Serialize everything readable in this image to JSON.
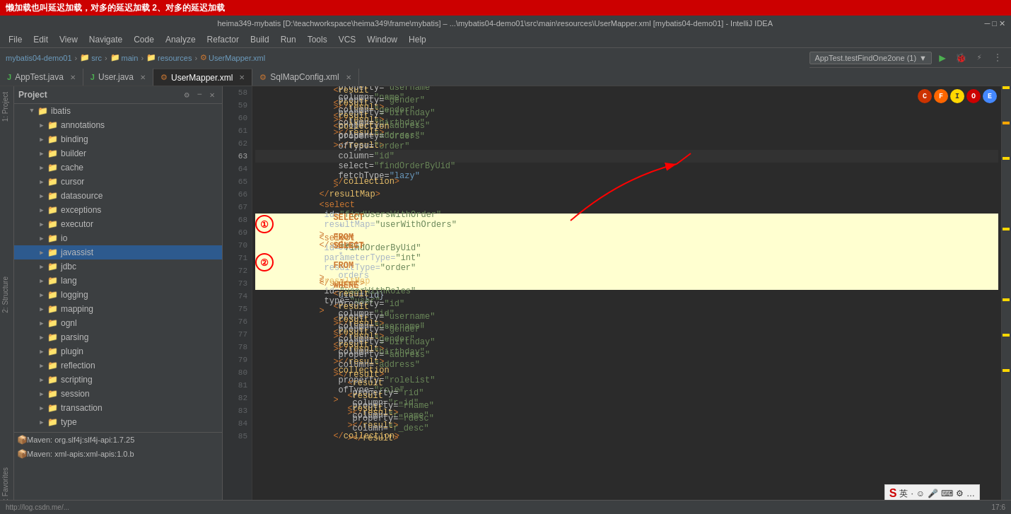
{
  "window": {
    "title": "heima349-mybatis [D:\\teachworkspace\\heima349\\frame\\mybatis] – ...\\mybatis04-demo01\\src\\main\\resources\\UserMapper.xml [mybatis04-demo01] - IntelliJ IDEA",
    "tab_title": "mybatis04-demo01",
    "breadcrumbs": [
      "src",
      "main",
      "resources",
      "UserMapper.xml"
    ]
  },
  "menu": {
    "items": [
      "File",
      "Edit",
      "View",
      "Navigate",
      "Code",
      "Analyze",
      "Refactor",
      "Build",
      "Run",
      "Tools",
      "VCS",
      "Window",
      "Help"
    ]
  },
  "tabs": [
    {
      "id": "apptest",
      "label": "AppTest.java",
      "active": false,
      "closable": true,
      "type": "java"
    },
    {
      "id": "user",
      "label": "User.java",
      "active": false,
      "closable": true,
      "type": "java"
    },
    {
      "id": "usermapper",
      "label": "UserMapper.xml",
      "active": true,
      "closable": true,
      "type": "xml"
    },
    {
      "id": "sqlmapconfig",
      "label": "SqlMapConfig.xml",
      "active": false,
      "closable": true,
      "type": "xml"
    }
  ],
  "run_config": {
    "label": "AppTest.testFindOne2one (1)"
  },
  "sidebar": {
    "title": "Project",
    "items": [
      {
        "id": "ibatis",
        "label": "ibatis",
        "level": 1,
        "type": "folder",
        "expanded": true
      },
      {
        "id": "annotations",
        "label": "annotations",
        "level": 2,
        "type": "folder",
        "expanded": false
      },
      {
        "id": "binding",
        "label": "binding",
        "level": 2,
        "type": "folder",
        "expanded": false
      },
      {
        "id": "builder",
        "label": "builder",
        "level": 2,
        "type": "folder",
        "expanded": false
      },
      {
        "id": "cache",
        "label": "cache",
        "level": 2,
        "type": "folder",
        "expanded": false,
        "selected": false
      },
      {
        "id": "cursor",
        "label": "cursor",
        "level": 2,
        "type": "folder",
        "expanded": false
      },
      {
        "id": "datasource",
        "label": "datasource",
        "level": 2,
        "type": "folder",
        "expanded": false
      },
      {
        "id": "exceptions",
        "label": "exceptions",
        "level": 2,
        "type": "folder",
        "expanded": false
      },
      {
        "id": "executor",
        "label": "executor",
        "level": 2,
        "type": "folder",
        "expanded": false
      },
      {
        "id": "io",
        "label": "io",
        "level": 2,
        "type": "folder",
        "expanded": false
      },
      {
        "id": "javassist",
        "label": "javassist",
        "level": 2,
        "type": "folder",
        "expanded": false,
        "selected": true
      },
      {
        "id": "jdbc",
        "label": "jdbc",
        "level": 2,
        "type": "folder",
        "expanded": false
      },
      {
        "id": "lang",
        "label": "lang",
        "level": 2,
        "type": "folder",
        "expanded": false
      },
      {
        "id": "logging",
        "label": "logging",
        "level": 2,
        "type": "folder",
        "expanded": false
      },
      {
        "id": "mapping",
        "label": "mapping",
        "level": 2,
        "type": "folder",
        "expanded": false
      },
      {
        "id": "ognl",
        "label": "ognl",
        "level": 2,
        "type": "folder",
        "expanded": false
      },
      {
        "id": "parsing",
        "label": "parsing",
        "level": 2,
        "type": "folder",
        "expanded": false
      },
      {
        "id": "plugin",
        "label": "plugin",
        "level": 2,
        "type": "folder",
        "expanded": false
      },
      {
        "id": "reflection",
        "label": "reflection",
        "level": 2,
        "type": "folder",
        "expanded": false
      },
      {
        "id": "scripting",
        "label": "scripting",
        "level": 2,
        "type": "folder",
        "expanded": false
      },
      {
        "id": "session",
        "label": "session",
        "level": 2,
        "type": "folder",
        "expanded": false
      },
      {
        "id": "transaction",
        "label": "transaction",
        "level": 2,
        "type": "folder",
        "expanded": false
      },
      {
        "id": "type",
        "label": "type",
        "level": 2,
        "type": "folder",
        "expanded": false
      }
    ],
    "maven_items": [
      {
        "label": "Maven: org.slf4j:slf4j-api:1.7.25"
      },
      {
        "label": "Maven: xml-apis:xml-apis:1.0.b"
      }
    ]
  },
  "code": {
    "lines": [
      {
        "num": 58,
        "content": "    <result property=\"username\" column=\"name\"></result>",
        "highlighted": false
      },
      {
        "num": 59,
        "content": "    <result property=\"gender\" column=\"gender\"></result>",
        "highlighted": false
      },
      {
        "num": 60,
        "content": "    <result property=\"birthday\" column=\"birthday\"></result>",
        "highlighted": false
      },
      {
        "num": 61,
        "content": "    <result property=\"address\" column=\"address\"></result>",
        "highlighted": false
      },
      {
        "num": 62,
        "content": "",
        "highlighted": false
      },
      {
        "num": 63,
        "content": "    <collection property=\"orders\" ofType=\"order\" column=\"id\" select=\"findOrderByUid\" fetchType=\"lazy\">",
        "highlighted": false,
        "current": true
      },
      {
        "num": 64,
        "content": "",
        "highlighted": false
      },
      {
        "num": 65,
        "content": "    </collection>",
        "highlighted": false
      },
      {
        "num": 66,
        "content": "</resultMap>",
        "highlighted": false
      },
      {
        "num": 67,
        "content": "",
        "highlighted": false
      },
      {
        "num": 68,
        "content": "<select id=\"findUsersWithOrder\" resultMap=\"userWithOrders\">",
        "highlighted": true
      },
      {
        "num": 69,
        "content": "    SELECT * FROM USER",
        "highlighted": true
      },
      {
        "num": 70,
        "content": "</select>",
        "highlighted": true
      },
      {
        "num": 71,
        "content": "<select id=\"findOrderByUid\" parameterType=\"int\" resultType=\"order\">",
        "highlighted": true
      },
      {
        "num": 72,
        "content": "    SELECT * FROM orders WHERE uid=#{id}",
        "highlighted": true
      },
      {
        "num": 73,
        "content": "</select>",
        "highlighted": true
      },
      {
        "num": 74,
        "content": "<resultMap id=\"userWithRoles\" type=\"user\">",
        "highlighted": false
      },
      {
        "num": 75,
        "content": "    <result property=\"id\" column=\"id\"></result>",
        "highlighted": false
      },
      {
        "num": 76,
        "content": "    <result property=\"username\" column=\"username\"></result>",
        "highlighted": false
      },
      {
        "num": 77,
        "content": "    <result property=\"gender\" column=\"gender\"></result>",
        "highlighted": false
      },
      {
        "num": 78,
        "content": "    <result property=\"birthday\" column=\"birthday\"></result>",
        "highlighted": false
      },
      {
        "num": 79,
        "content": "    <result property=\"address\" column=\"address\"></result>",
        "highlighted": false
      },
      {
        "num": 80,
        "content": "",
        "highlighted": false
      },
      {
        "num": 81,
        "content": "    <collection property=\"roleList\" ofType=\"role\">",
        "highlighted": false
      },
      {
        "num": 82,
        "content": "        <result property=\"rid\" column=\"r_id\"></result>",
        "highlighted": false
      },
      {
        "num": 83,
        "content": "        <result property=\"rname\" column=\"r_name\"></result>",
        "highlighted": false
      },
      {
        "num": 84,
        "content": "        <result property=\"rdesc\" column=\"r_desc\"></result>",
        "highlighted": false
      },
      {
        "num": 85,
        "content": "    </collection>",
        "highlighted": false
      }
    ]
  },
  "header_annotation": {
    "text": "懒加载也叫延迟加载，对多的延迟加载    2、对多的延迟加载"
  },
  "status_bar": {
    "log_text": "http://log.csdn.me/...",
    "time": "17:6"
  },
  "browser_icons": {
    "colors": [
      "#cc0000",
      "#ff6600",
      "#ffd700",
      "#cc0000",
      "#4488ff"
    ]
  }
}
